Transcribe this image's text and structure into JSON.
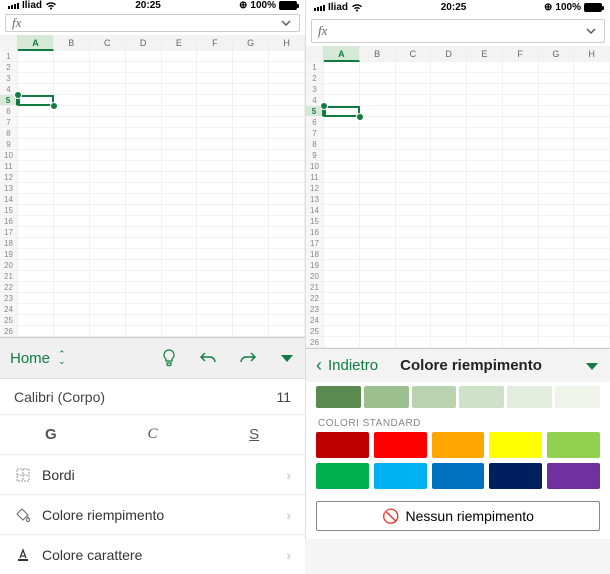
{
  "status": {
    "carrier": "Iliad",
    "time": "20:25",
    "battery_pct": "100%"
  },
  "formula_prefix": "fx",
  "columns": [
    "A",
    "B",
    "C",
    "D",
    "E",
    "F",
    "G",
    "H"
  ],
  "rows": [
    1,
    2,
    3,
    4,
    5,
    6,
    7,
    8,
    9,
    10,
    11,
    12,
    13,
    14,
    15,
    16,
    17,
    18,
    19,
    20,
    21,
    22,
    23,
    24,
    25,
    26
  ],
  "selected": {
    "col": "A",
    "row": 5
  },
  "left_panel": {
    "tab": "Home",
    "font_name": "Calibri (Corpo)",
    "font_size": "11",
    "style_labels": {
      "bold": "G",
      "italic": "C",
      "underline": "S"
    },
    "menu": {
      "borders": "Bordi",
      "fill": "Colore riempimento",
      "font_color": "Colore carattere"
    }
  },
  "right_panel": {
    "back": "Indietro",
    "title": "Colore riempimento",
    "theme_greens": [
      "#5a8a4f",
      "#9bbf8e",
      "#b9d3b0",
      "#d0e1c9",
      "#e3edde",
      "#eef4ea"
    ],
    "section_std": "COLORI STANDARD",
    "standard_colors": [
      "#c00000",
      "#ff0000",
      "#ffa500",
      "#ffff00",
      "#92d050",
      "#00b050",
      "#00b0f0",
      "#0070c0",
      "#001f5f",
      "#7030a0"
    ],
    "no_fill": "Nessun riempimento"
  }
}
